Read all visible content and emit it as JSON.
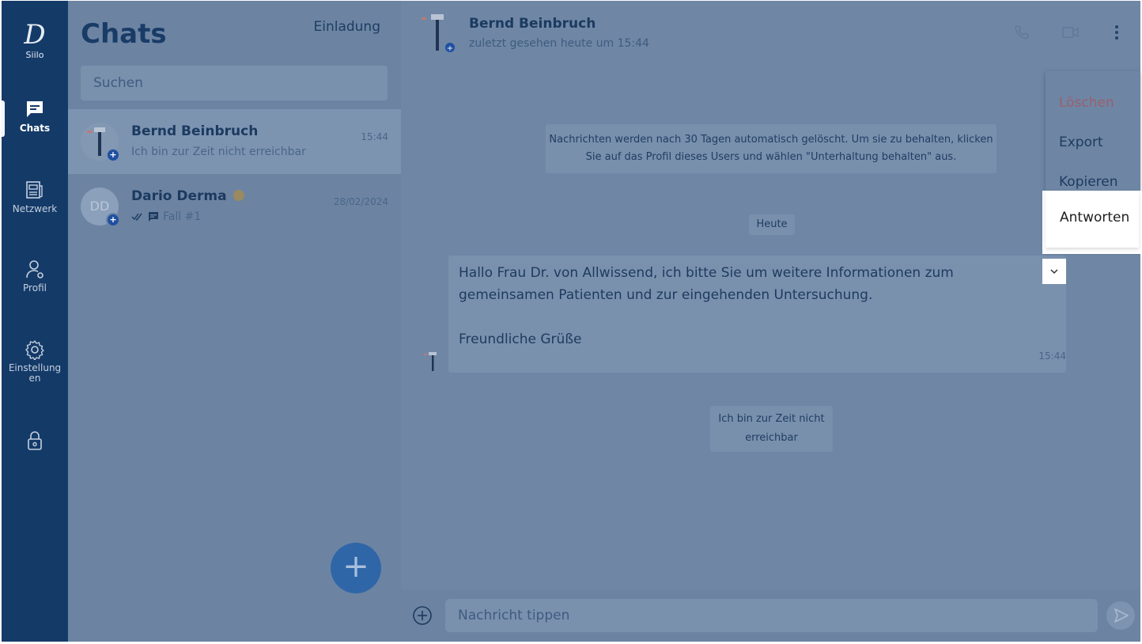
{
  "app": {
    "logo_mark": "D",
    "brand": "Siilo"
  },
  "rail": {
    "items": [
      {
        "label": "Chats",
        "icon": "chat-icon"
      },
      {
        "label": "Netzwerk",
        "icon": "network-icon"
      },
      {
        "label": "Profil",
        "icon": "profile-icon"
      },
      {
        "label": "Einstellung\nen",
        "icon": "gear-icon"
      },
      {
        "label": "",
        "icon": "lock-icon"
      }
    ]
  },
  "list": {
    "title": "Chats",
    "invite_label": "Einladung",
    "search_placeholder": "Suchen",
    "chats": [
      {
        "name": "Bernd Beinbruch",
        "preview": "Ich bin zur Zeit nicht erreichbar",
        "time": "15:44"
      },
      {
        "name": "Dario Derma",
        "initials": "DD",
        "preview": "Fall #1",
        "time": "28/02/2024"
      }
    ],
    "fab_label": "+"
  },
  "conversation": {
    "contact_name": "Bernd Beinbruch",
    "contact_status": "zuletzt gesehen heute um 15:44",
    "system_note": "Nachrichten werden nach 30 Tagen automatisch gelöscht. Um sie zu behalten, klicken Sie auf das Profil dieses Users und wählen \"Unterhaltung behalten\" aus.",
    "date_divider": "Heute",
    "message": {
      "line1": "Hallo Frau Dr. von Allwissend, ich bitte Sie um weitere Informationen zum gemeinsamen Patienten und zur eingehenden Untersuchung.",
      "line2": "Freundliche Grüße",
      "time": "15:44"
    },
    "auto_reply": "Ich bin zur Zeit nicht erreichbar",
    "composer_placeholder": "Nachricht tippen"
  },
  "context_menu": {
    "items": [
      "Löschen",
      "Export",
      "Kopieren",
      "Antworten"
    ],
    "danger_color": "#9a5f6e"
  }
}
